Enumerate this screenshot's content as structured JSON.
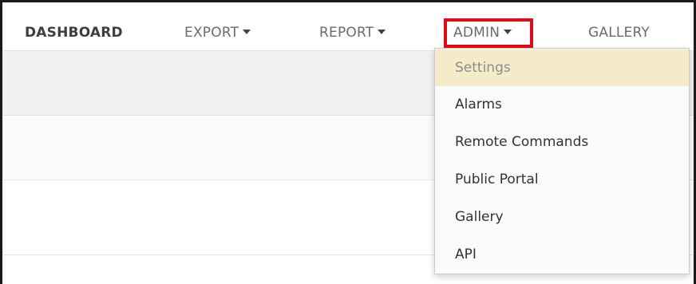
{
  "nav": {
    "dashboard": "DASHBOARD",
    "export": "EXPORT",
    "report": "REPORT",
    "admin": "ADMIN",
    "gallery": "GALLERY"
  },
  "admin_menu": {
    "items": [
      {
        "label": "Settings"
      },
      {
        "label": "Alarms"
      },
      {
        "label": "Remote Commands"
      },
      {
        "label": "Public Portal"
      },
      {
        "label": "Gallery"
      },
      {
        "label": "API"
      }
    ]
  },
  "colors": {
    "highlight_border": "#e00c1a",
    "hover_bg": "#f5ebc8"
  }
}
